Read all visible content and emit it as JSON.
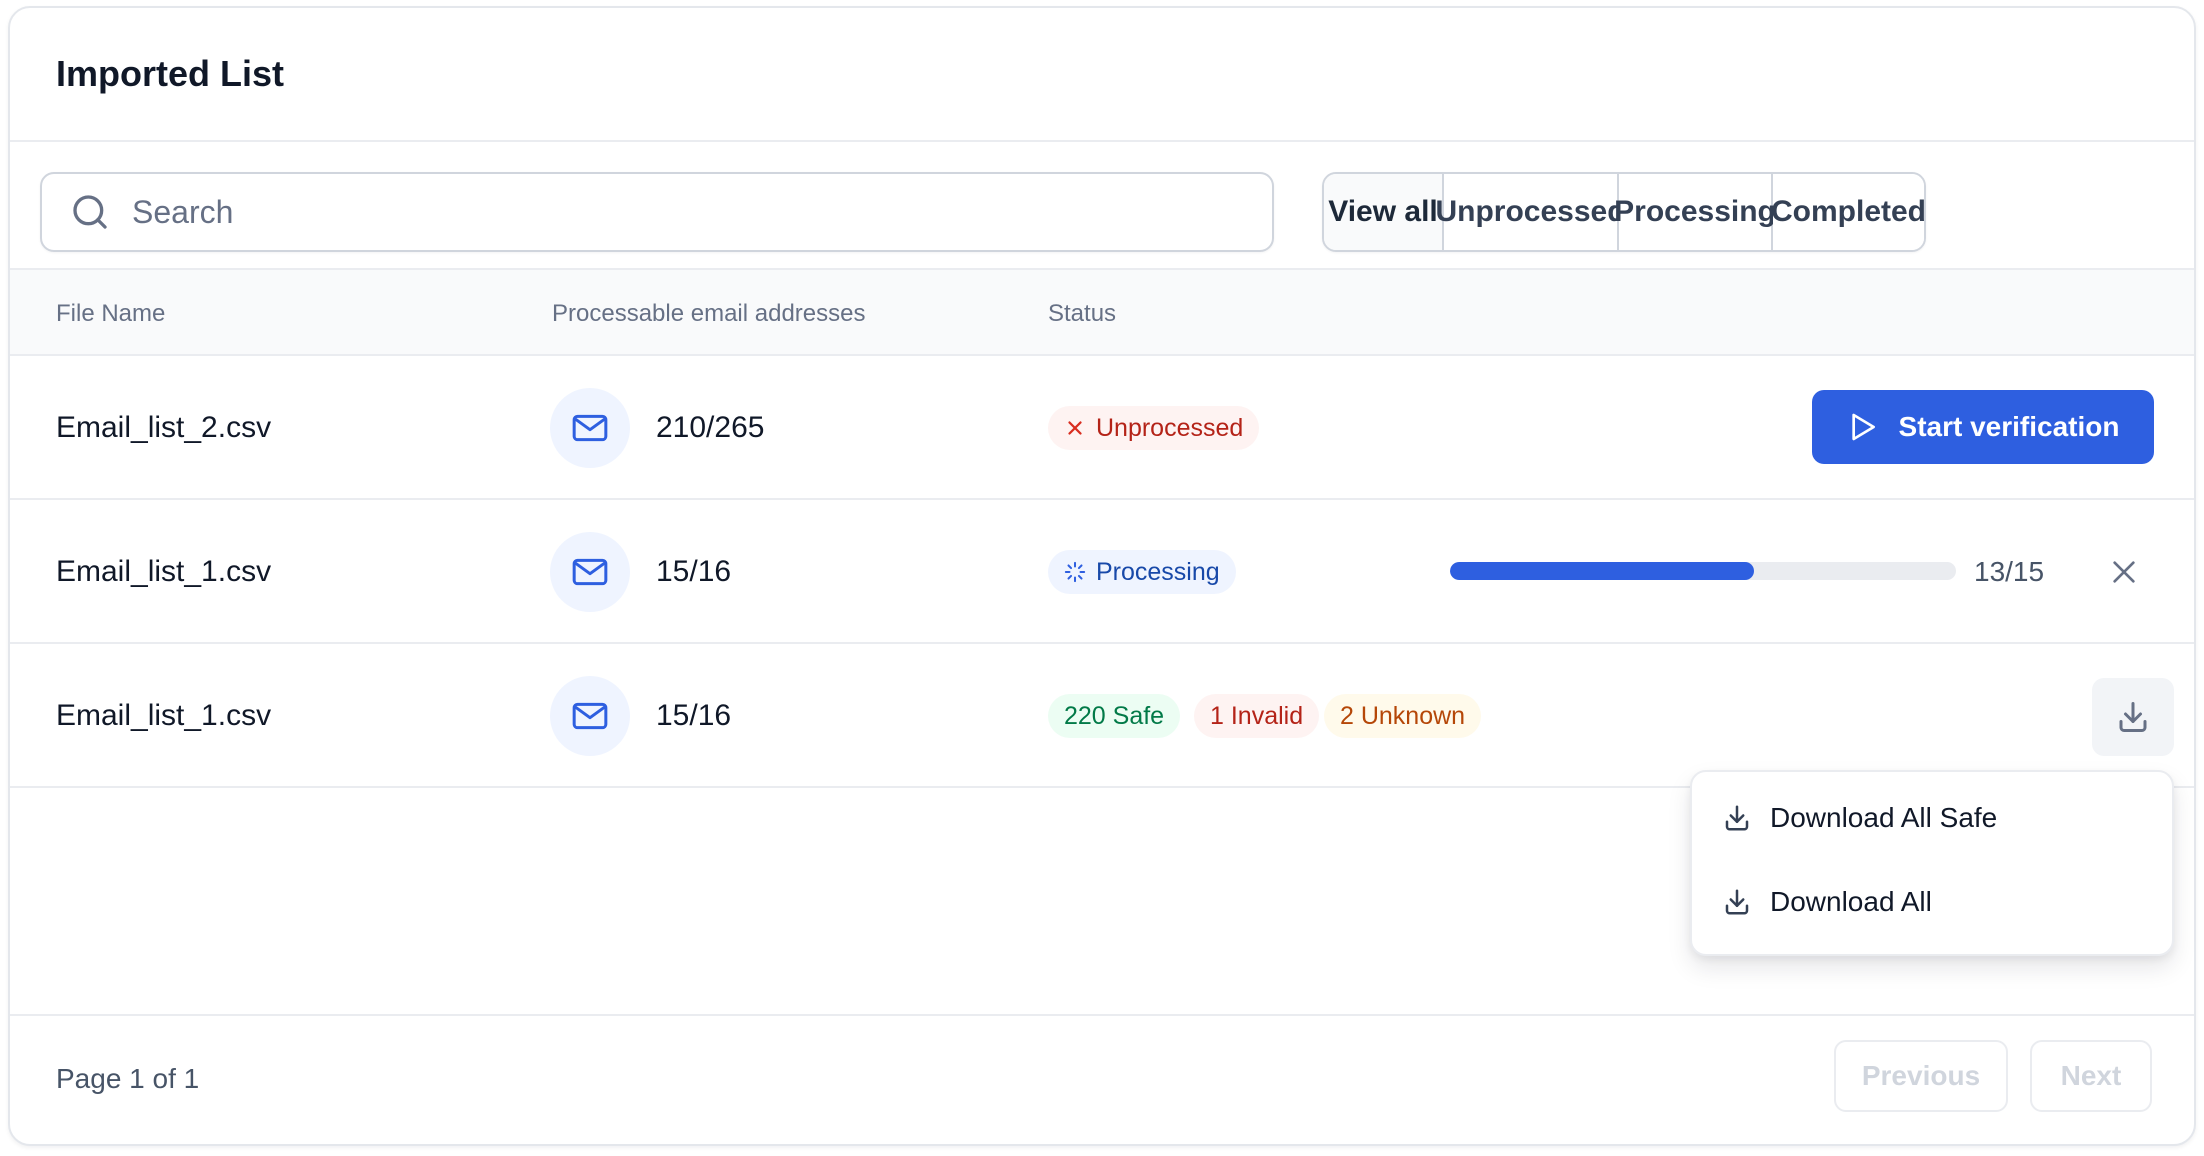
{
  "header": {
    "title": "Imported List"
  },
  "search": {
    "placeholder": "Search",
    "value": ""
  },
  "filters": {
    "view_all": "View all",
    "unprocessed": "Unprocessed",
    "processing": "Processing",
    "completed": "Completed",
    "active": "View all"
  },
  "table": {
    "columns": {
      "file_name": "File Name",
      "emails": "Processable email addresses",
      "status": "Status"
    },
    "rows": [
      {
        "file_name": "Email_list_2.csv",
        "count": "210/265",
        "status": "Unprocessed",
        "action_label": "Start verification"
      },
      {
        "file_name": "Email_list_1.csv",
        "count": "15/16",
        "status": "Processing",
        "progress_text": "13/15",
        "progress_fraction": 0.6
      },
      {
        "file_name": "Email_list_1.csv",
        "count": "15/16",
        "results": {
          "safe": "220 Safe",
          "invalid": "1 Invalid",
          "unknown": "2 Unknown"
        }
      }
    ]
  },
  "dropdown": {
    "items": [
      "Download All Safe",
      "Download All"
    ]
  },
  "footer": {
    "page_info": "Page 1 of 1",
    "previous": "Previous",
    "next": "Next"
  },
  "colors": {
    "primary": "#2e5fe0",
    "unprocessed": "#b42318",
    "processing": "#1849a9",
    "safe": "#027a48",
    "unknown": "#b54708"
  },
  "icons": {
    "search": "search-icon",
    "mail": "mail-icon",
    "play": "play-icon",
    "close": "close-icon",
    "download": "download-icon",
    "spinner": "spinner-icon"
  }
}
